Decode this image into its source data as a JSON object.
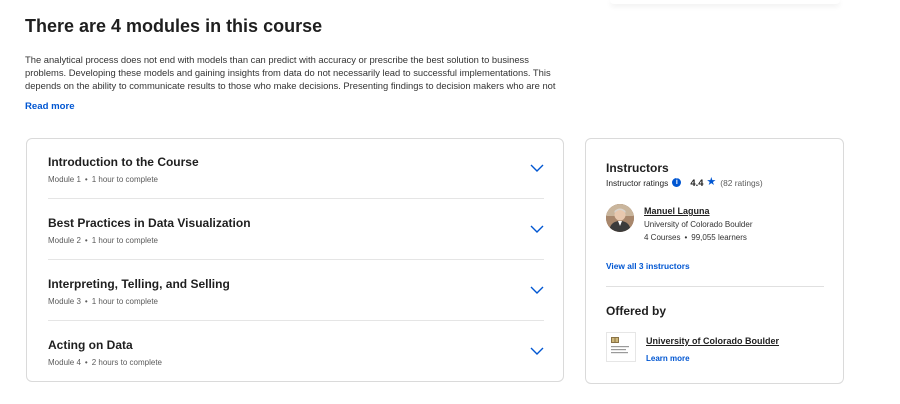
{
  "section": {
    "heading": "There are 4 modules in this course",
    "description": "The analytical process does not end with models than can predict with accuracy or prescribe the best solution to business problems. Developing these models and gaining insights from data do not necessarily lead to successful implementations. This depends on the ability to communicate results to those who make decisions. Presenting findings to decision makers who are not familiar with the",
    "read_more": "Read more"
  },
  "modules": [
    {
      "title": "Introduction to the Course",
      "module_label": "Module 1",
      "duration": "1 hour to complete"
    },
    {
      "title": "Best Practices in Data Visualization",
      "module_label": "Module 2",
      "duration": "1 hour to complete"
    },
    {
      "title": "Interpreting, Telling, and Selling",
      "module_label": "Module 3",
      "duration": "1 hour to complete"
    },
    {
      "title": "Acting on Data",
      "module_label": "Module 4",
      "duration": "2 hours to complete"
    }
  ],
  "instructors": {
    "title": "Instructors",
    "ratings_label": "Instructor ratings",
    "rating": "4.4",
    "rating_count": "(82 ratings)",
    "instructor": {
      "name": "Manuel Laguna",
      "org": "University of Colorado Boulder",
      "courses": "4 Courses",
      "learners": "99,055 learners"
    },
    "view_all": "View all 3 instructors"
  },
  "offered_by": {
    "title": "Offered by",
    "org_name": "University of Colorado Boulder",
    "learn_more": "Learn more",
    "logo_text": "University of Colorado Boulder"
  },
  "colors": {
    "accent": "#0056d2",
    "text": "#1f1f1f",
    "border": "#dadada"
  },
  "icons": [
    "chevron-down-icon",
    "info-icon",
    "star-icon",
    "avatar",
    "org-logo"
  ]
}
